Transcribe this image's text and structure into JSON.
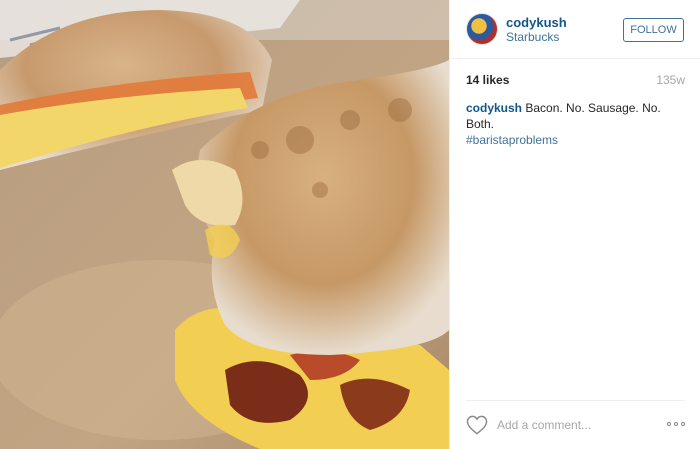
{
  "post": {
    "photo_icon": "breakfast-sandwich-photo",
    "username": "codykush",
    "location": "Starbucks",
    "follow_label": "FOLLOW",
    "likes": "14 likes",
    "age": "135w",
    "caption": {
      "username": "codykush",
      "text": " Bacon. No. Sausage. No. Both.",
      "hashtag": "#baristaproblems"
    },
    "comment_placeholder": "Add a comment...",
    "icons": {
      "like": "heart-icon",
      "more": "more-options-icon"
    }
  }
}
